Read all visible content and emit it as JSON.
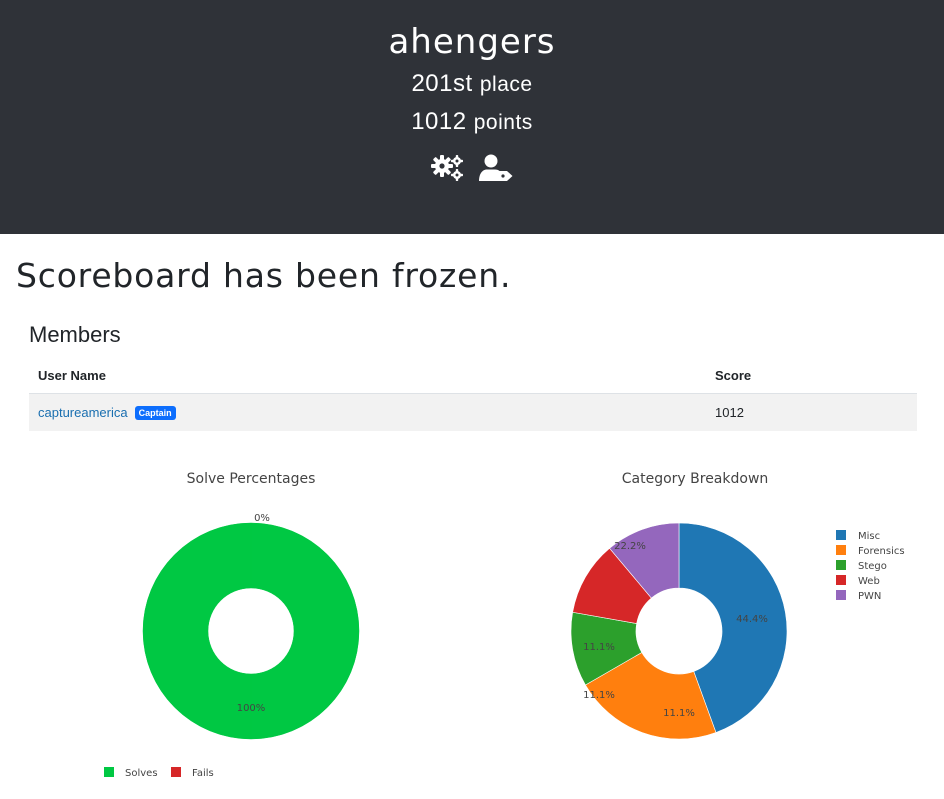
{
  "team": {
    "name": "ahengers",
    "place_number": "201st",
    "place_label": "place",
    "points_number": "1012",
    "points_label": "points",
    "icons": [
      "gears-icon",
      "user-tag-icon"
    ]
  },
  "notice": "Scoreboard has been frozen.",
  "members": {
    "title": "Members",
    "headers": [
      "User Name",
      "Score"
    ],
    "rows": [
      {
        "user": "captureamerica",
        "badge": "Captain",
        "score": "1012"
      }
    ]
  },
  "colors": {
    "header_bg": "#2f3238",
    "link": "#1a6fb0",
    "badge": "#0d6efd"
  },
  "chart_data": [
    {
      "type": "pie",
      "title": "Solve Percentages",
      "hole": true,
      "categories": [
        "Solves",
        "Fails"
      ],
      "values": [
        100,
        0
      ],
      "labels": [
        "100%",
        "0%"
      ],
      "colors": [
        "#00c843",
        "#d62728"
      ],
      "legend": "bottom"
    },
    {
      "type": "pie",
      "title": "Category Breakdown",
      "hole": true,
      "categories": [
        "Misc",
        "Forensics",
        "Stego",
        "Web",
        "PWN"
      ],
      "values": [
        44.4,
        22.2,
        11.1,
        11.1,
        11.1
      ],
      "labels": [
        "44.4%",
        "22.2%",
        "11.1%",
        "11.1%",
        "11.1%"
      ],
      "colors": [
        "#1f77b4",
        "#ff7f0e",
        "#2ca02c",
        "#d62728",
        "#9467bd"
      ],
      "legend": "right"
    }
  ]
}
